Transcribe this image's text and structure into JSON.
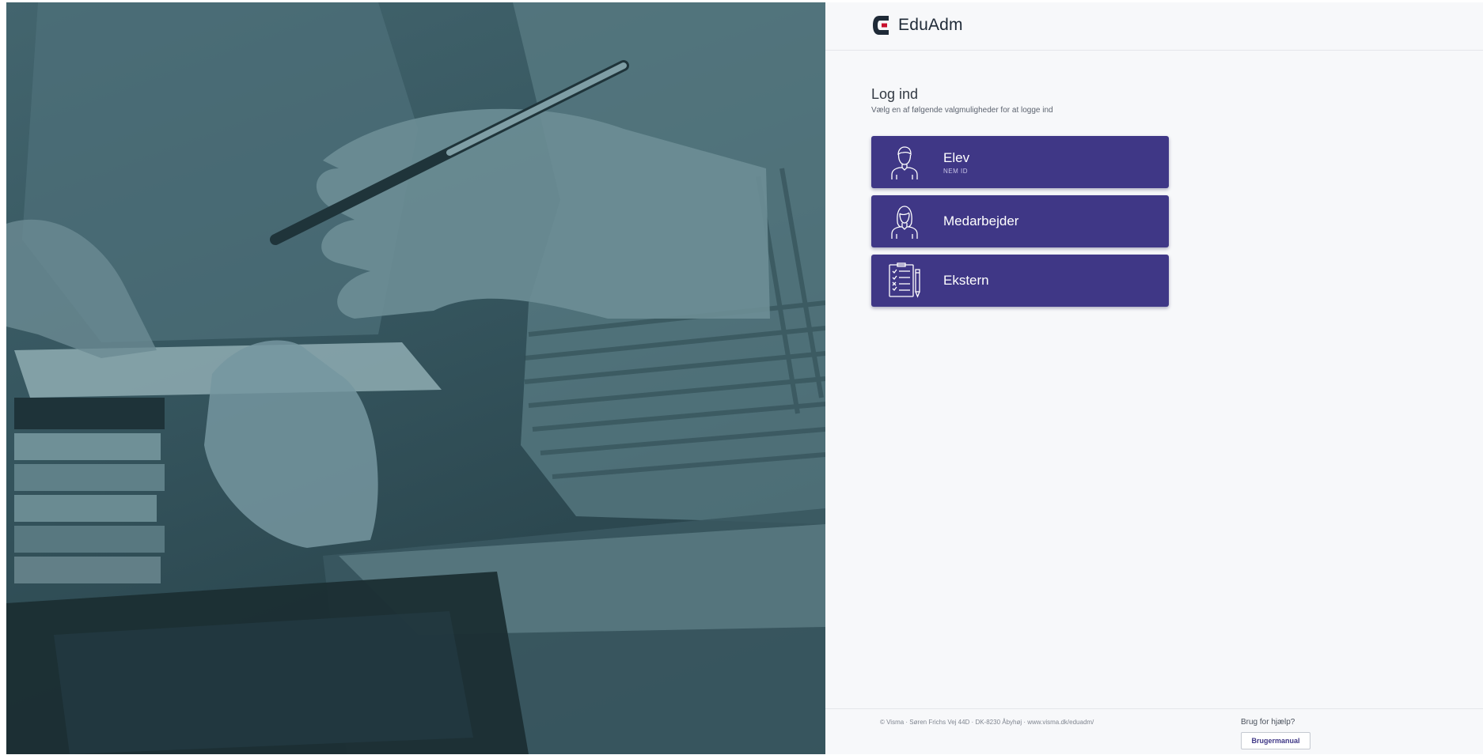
{
  "app": {
    "logo_text": "EduAdm",
    "logo_icon": "eduadm-logo-icon",
    "brand_color": "#3f3786",
    "logo_accent": "#c8102e"
  },
  "hero": {
    "image": "hero-photo-classroom-hands-pencil-books",
    "tint": "#3d5e67"
  },
  "login": {
    "title": "Log ind",
    "subtitle": "Vælg en af følgende valgmuligheder for at logge ind",
    "options": [
      {
        "label": "Elev",
        "sublabel": "NEM ID",
        "icon": "student-icon"
      },
      {
        "label": "Medarbejder",
        "sublabel": "",
        "icon": "employee-icon"
      },
      {
        "label": "Ekstern",
        "sublabel": "",
        "icon": "checklist-document-icon"
      }
    ]
  },
  "footer": {
    "copyright": "© Visma · Søren Frichs Vej 44D · DK-8230 Åbyhøj · www.visma.dk/eduadm/",
    "help_label": "Brug for hjælp?",
    "manual_button": "Brugermanual"
  }
}
